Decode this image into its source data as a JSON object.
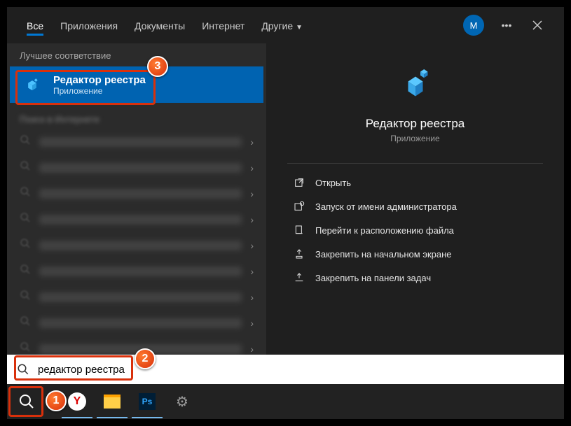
{
  "tabs": {
    "all": "Все",
    "apps": "Приложения",
    "docs": "Документы",
    "internet": "Интернет",
    "more": "Другие"
  },
  "avatar_letter": "M",
  "left": {
    "best_match_header": "Лучшее соответствие",
    "result_title": "Редактор реестра",
    "result_sub": "Приложение",
    "web_header": "Поиск в Интернете"
  },
  "right": {
    "title": "Редактор реестра",
    "sub": "Приложение",
    "actions": {
      "open": "Открыть",
      "admin": "Запуск от имени администратора",
      "location": "Перейти к расположению файла",
      "pin_start": "Закрепить на начальном экране",
      "pin_taskbar": "Закрепить на панели задач"
    }
  },
  "search": {
    "value": "редактор реестра"
  },
  "callouts": {
    "c1": "1",
    "c2": "2",
    "c3": "3"
  }
}
